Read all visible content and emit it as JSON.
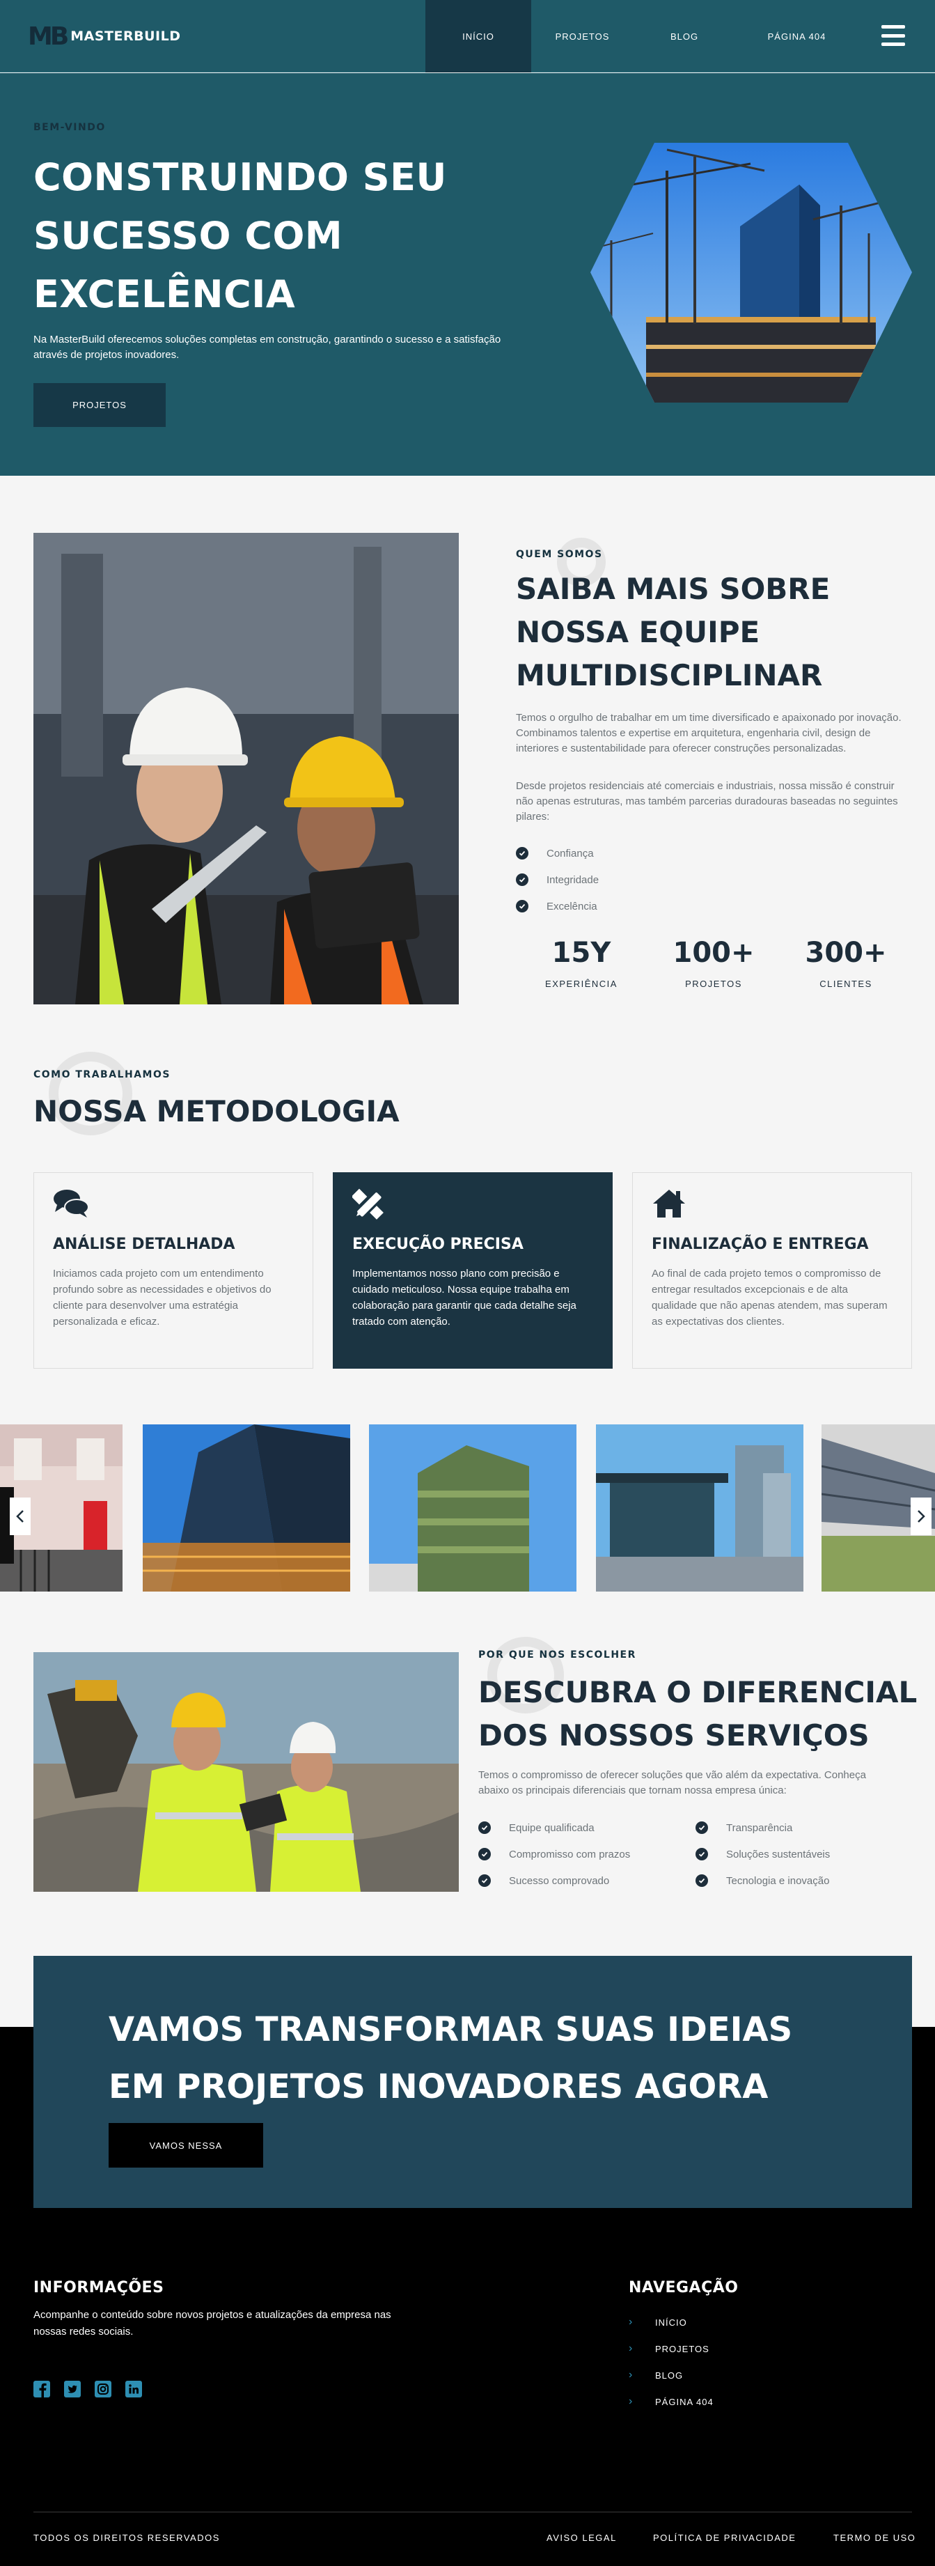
{
  "nav": {
    "logo_mark": "MB",
    "logo_text": "MASTERBUILD",
    "links": [
      "INÍCIO",
      "PROJETOS",
      "BLOG",
      "PÁGINA 404"
    ]
  },
  "hero": {
    "kicker": "BEM-VINDO",
    "title_lines": [
      "CONSTRUINDO SEU",
      "SUCESSO COM",
      "EXCELÊNCIA"
    ],
    "description": "Na MasterBuild oferecemos soluções completas em construção, garantindo o sucesso e a satisfação através de projetos inovadores.",
    "button": "PROJETOS"
  },
  "about": {
    "kicker": "QUEM SOMOS",
    "title_lines": [
      "SAIBA MAIS SOBRE",
      "NOSSA EQUIPE",
      "MULTIDISCIPLINAR"
    ],
    "p1": "Temos o orgulho de trabalhar em um time diversificado e apaixonado por inovação. Combinamos talentos e expertise em arquitetura, engenharia civil, design de interiores e sustentabilidade para oferecer construções personalizadas.",
    "p2": "Desde projetos residenciais até comerciais e industriais, nossa missão é construir não apenas estruturas, mas também parcerias duradouras baseadas no seguintes pilares:",
    "pillars": [
      "Confiança",
      "Integridade",
      "Excelência"
    ],
    "stats": [
      {
        "num": "15Y",
        "label": "EXPERIÊNCIA"
      },
      {
        "num": "100+",
        "label": "PROJETOS"
      },
      {
        "num": "300+",
        "label": "CLIENTES"
      }
    ]
  },
  "method": {
    "kicker": "COMO TRABALHAMOS",
    "title": "NOSSA METODOLOGIA",
    "cards": [
      {
        "icon": "comments-icon",
        "title": "ANÁLISE DETALHADA",
        "text": "Iniciamos cada projeto com um entendimento profundo sobre as necessidades e objetivos do cliente para desenvolver uma estratégia personalizada e eficaz."
      },
      {
        "icon": "pencil-ruler-icon",
        "title": "EXECUÇÃO PRECISA",
        "text": "Implementamos nosso plano com precisão e cuidado meticuloso. Nossa equipe trabalha em colaboração para garantir que cada detalhe seja tratado com atenção."
      },
      {
        "icon": "home-icon",
        "title": "FINALIZAÇÃO E ENTREGA",
        "text": "Ao final de cada projeto temos o compromisso de entregar resultados excepcionais e de alta qualidade que não apenas atendem, mas superam as expectativas dos clientes."
      }
    ]
  },
  "why": {
    "kicker": "POR QUE NOS ESCOLHER",
    "title_lines": [
      "DESCUBRA O DIFERENCIAL",
      "DOS NOSSOS SERVIÇOS"
    ],
    "description": "Temos o compromisso de oferecer soluções que vão além da expectativa. Conheça abaixo os principais diferenciais que tornam nossa empresa única:",
    "left": [
      "Equipe qualificada",
      "Compromisso com prazos",
      "Sucesso comprovado"
    ],
    "right": [
      "Transparência",
      "Soluções sustentáveis",
      "Tecnologia e inovação"
    ]
  },
  "cta": {
    "title_lines": [
      "VAMOS TRANSFORMAR SUAS IDEIAS",
      "EM PROJETOS INOVADORES AGORA"
    ],
    "button": "VAMOS NESSA"
  },
  "footer": {
    "info_title": "INFORMAÇÕES",
    "info_text": "Acompanhe o conteúdo sobre novos projetos e atualizações da empresa nas nossas redes sociais.",
    "social": [
      "facebook-icon",
      "twitter-icon",
      "instagram-icon",
      "linkedin-icon"
    ],
    "nav_title": "NAVEGAÇÃO",
    "nav_links": [
      "INÍCIO",
      "PROJETOS",
      "BLOG",
      "PÁGINA 404"
    ],
    "rights": "TODOS OS DIREITOS RESERVADOS",
    "legal_links": [
      "AVISO LEGAL",
      "POLÍTICA DE PRIVACIDADE",
      "TERMO DE USO"
    ]
  },
  "colors": {
    "primary": "#1f5a68",
    "dark": "#1b3442",
    "cta": "#21475a",
    "text": "#1d2d3a",
    "muted": "#6c7378",
    "accent": "#2e8fb3"
  }
}
